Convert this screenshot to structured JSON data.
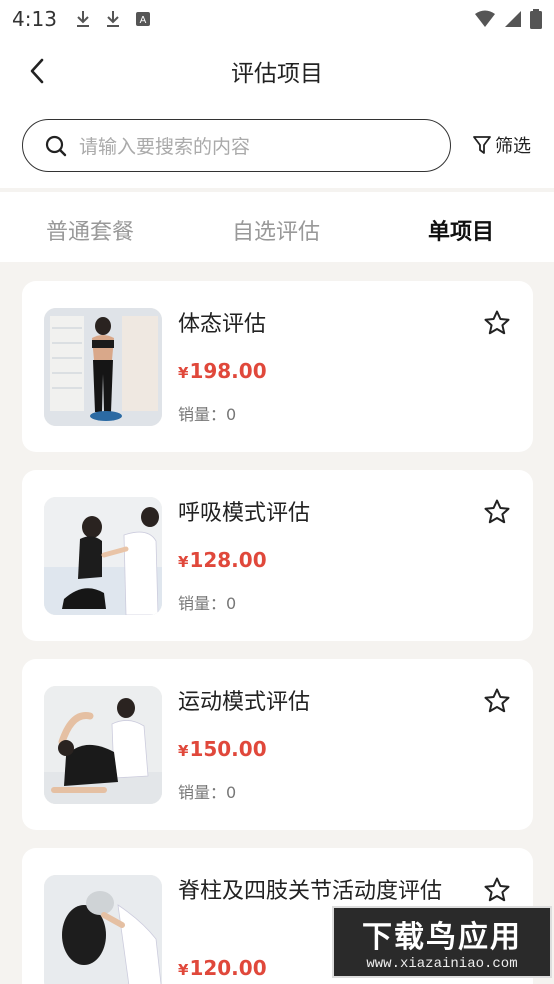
{
  "status_bar": {
    "time": "4:13"
  },
  "header": {
    "title": "评估项目"
  },
  "search": {
    "placeholder": "请输入要搜索的内容",
    "filter_label": "筛选"
  },
  "tabs": [
    {
      "label": "普通套餐",
      "active": false
    },
    {
      "label": "自选评估",
      "active": false
    },
    {
      "label": "单项目",
      "active": true
    }
  ],
  "items": [
    {
      "name": "体态评估",
      "currency": "¥",
      "price": "198.00",
      "sales": "销量：0"
    },
    {
      "name": "呼吸模式评估",
      "currency": "¥",
      "price": "128.00",
      "sales": "销量：0"
    },
    {
      "name": "运动模式评估",
      "currency": "¥",
      "price": "150.00",
      "sales": "销量：0"
    },
    {
      "name": "脊柱及四肢关节活动度评估",
      "currency": "¥",
      "price": "120.00",
      "sales": ""
    }
  ],
  "watermark": {
    "main": "下载鸟应用",
    "url": "www.xiazainiao.com"
  },
  "colors": {
    "price": "#e0483b",
    "tab_accent": "#f38e4a",
    "page_bg": "#f5f3f0"
  }
}
